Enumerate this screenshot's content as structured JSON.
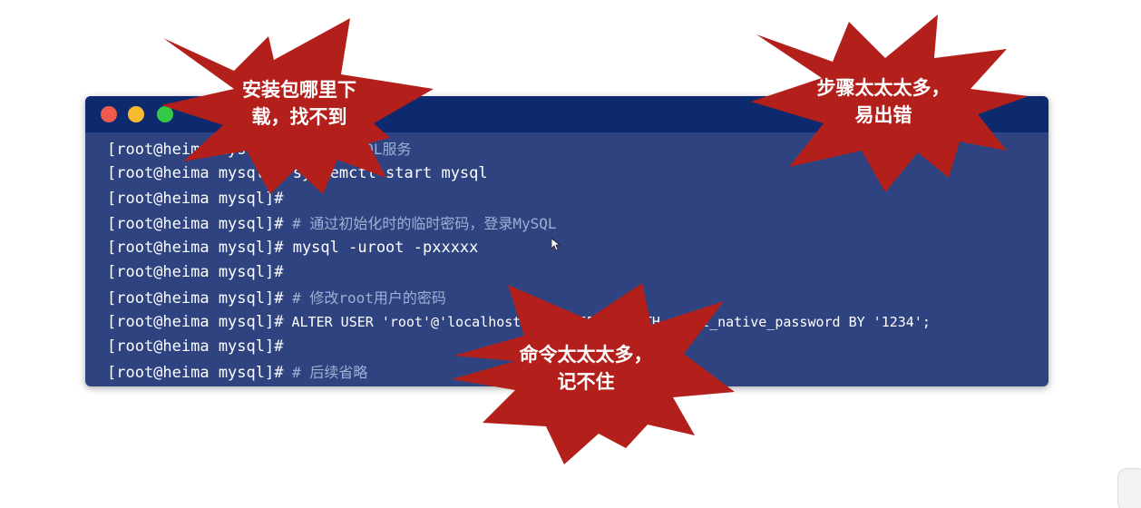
{
  "terminal": {
    "window_controls": [
      "close",
      "minimize",
      "maximize"
    ],
    "lines": [
      {
        "prompt": "[root@heima mysql]#",
        "text": " # 启动MySQL服务",
        "kind": "comment"
      },
      {
        "prompt": "[root@heima mysql]#",
        "text": " systemctl start mysql",
        "kind": "cmd"
      },
      {
        "prompt": "[root@heima mysql]#",
        "text": "",
        "kind": "cmd"
      },
      {
        "prompt": "[root@heima mysql]#",
        "text": " # 通过初始化时的临时密码，登录MySQL",
        "kind": "comment"
      },
      {
        "prompt": "[root@heima mysql]#",
        "text": " mysql -uroot -pxxxxx",
        "kind": "cmd"
      },
      {
        "prompt": "[root@heima mysql]#",
        "text": "",
        "kind": "cmd"
      },
      {
        "prompt": "[root@heima mysql]#",
        "text": " # 修改root用户的密码",
        "kind": "comment"
      },
      {
        "prompt": "[root@heima mysql]#",
        "text": " ALTER USER 'root'@'localhost' IDENTIFIED WITH mysql_native_password BY '1234';",
        "kind": "cmd-small"
      },
      {
        "prompt": "[root@heima mysql]#",
        "text": "",
        "kind": "cmd"
      },
      {
        "prompt": "[root@heima mysql]#",
        "text": " # 后续省略",
        "kind": "comment"
      }
    ]
  },
  "bursts": {
    "download": {
      "line1": "安装包哪里下",
      "line2": "载，找不到"
    },
    "steps": {
      "line1": "步骤太太太多，",
      "line2": "易出错"
    },
    "commands": {
      "line1": "命令太太太多，",
      "line2": "记不住"
    }
  },
  "colors": {
    "terminal_body": "#2e4380",
    "terminal_titlebar": "#0e2a6e",
    "burst_fill": "#b3201c",
    "close_dot": "#f05b50",
    "minimize_dot": "#f6bb2e",
    "maximize_dot": "#35c94a"
  }
}
